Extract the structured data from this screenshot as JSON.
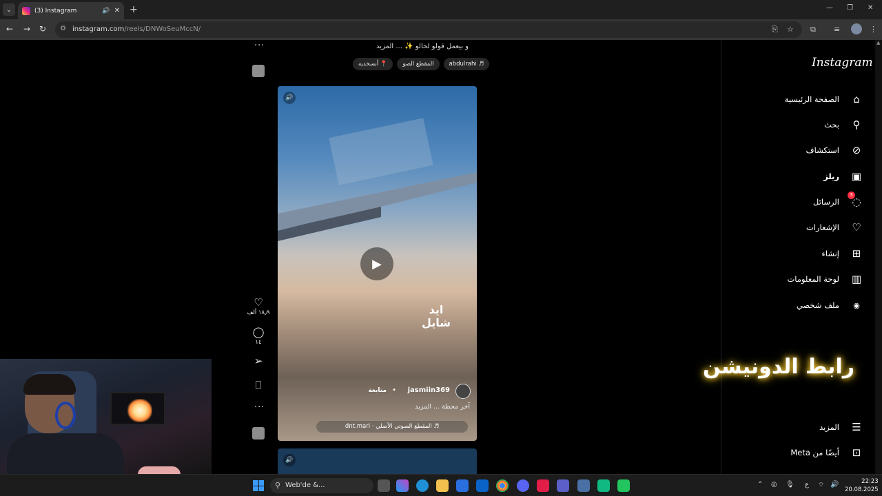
{
  "browser": {
    "tab_title": "(3) Instagram",
    "url_host": "instagram.com",
    "url_path": "/reels/DNWoSeuMccN/"
  },
  "reel_prev": {
    "caption": "و بيعمل قولو لحالو ✨ ... المزيد",
    "chips": [
      "♬ abdulrahi",
      "المقطع الصو",
      "📍 أنسخديه"
    ]
  },
  "reel": {
    "overlay_text": "ايد شايل",
    "username": "jasmiin369",
    "follow": "متابعة",
    "dot": "•",
    "caption": "آخر محطة ... المزيد",
    "audio": "♬ المقطع الصوتي الأصلي · dnt.mari",
    "likes": "١٨٫٩ ألف",
    "comments": "١٤"
  },
  "sidebar": {
    "logo": "Instagram",
    "items": [
      {
        "label": "الصفحة الرئيسية",
        "icon": "home-icon"
      },
      {
        "label": "بحث",
        "icon": "search-icon"
      },
      {
        "label": "استكشاف",
        "icon": "compass-icon"
      },
      {
        "label": "ريلز",
        "icon": "reels-icon"
      },
      {
        "label": "الرسائل",
        "icon": "messenger-icon",
        "badge": "3"
      },
      {
        "label": "الإشعارات",
        "icon": "heart-icon"
      },
      {
        "label": "إنشاء",
        "icon": "plus-square-icon"
      },
      {
        "label": "لوحة المعلومات",
        "icon": "dashboard-icon"
      },
      {
        "label": "ملف شخصي",
        "icon": "profile-avatar"
      }
    ],
    "more": "المزيد",
    "meta": "أيضًا من Meta"
  },
  "overlay_banner": "رابط الدونيشن",
  "taskbar": {
    "search": "Web'de &...",
    "lang": "ع",
    "time": "22:23",
    "date": "20.08.2025"
  },
  "colors": {
    "badge": "#ff3040",
    "banner_glow": "#ffcc00",
    "windows_blue": "#3b9cff"
  }
}
